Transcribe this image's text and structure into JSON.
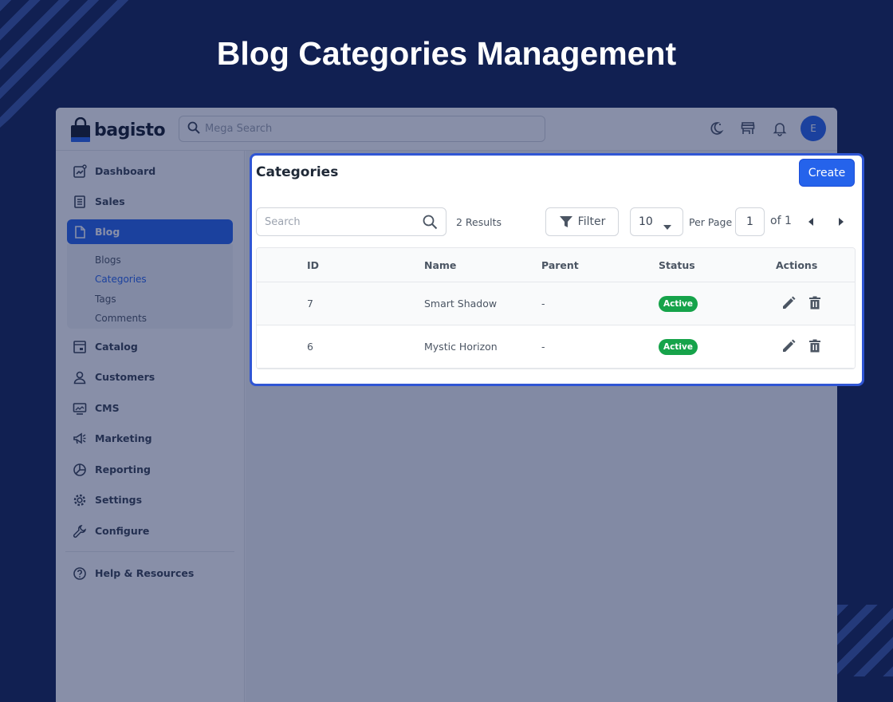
{
  "hero": {
    "title": "Blog Categories Management"
  },
  "app": {
    "logo_text": "bagisto",
    "search_placeholder": "Mega Search",
    "avatar_letter": "E"
  },
  "sidebar": {
    "items": [
      {
        "label": "Dashboard",
        "icon": "dashboard-icon"
      },
      {
        "label": "Sales",
        "icon": "receipt-icon"
      },
      {
        "label": "Blog",
        "icon": "document-icon"
      },
      {
        "label": "Catalog",
        "icon": "catalog-icon"
      },
      {
        "label": "Customers",
        "icon": "user-icon"
      },
      {
        "label": "CMS",
        "icon": "monitor-icon"
      },
      {
        "label": "Marketing",
        "icon": "megaphone-icon"
      },
      {
        "label": "Reporting",
        "icon": "pie-chart-icon"
      },
      {
        "label": "Settings",
        "icon": "gear-icon"
      },
      {
        "label": "Configure",
        "icon": "wrench-icon"
      },
      {
        "label": "Help & Resources",
        "icon": "question-icon"
      }
    ],
    "blog_submenu": [
      "Blogs",
      "Categories",
      "Tags",
      "Comments"
    ],
    "active_item": "Blog",
    "active_subitem": "Categories"
  },
  "panel": {
    "title": "Categories",
    "create_label": "Create",
    "search_placeholder": "Search",
    "results_text": "2 Results",
    "filter_label": "Filter",
    "per_page_value": "10",
    "per_page_label": "Per Page",
    "page_value": "1",
    "page_of": "of 1"
  },
  "table": {
    "columns": [
      "ID",
      "Name",
      "Parent",
      "Status",
      "Actions"
    ],
    "rows": [
      {
        "id": "7",
        "name": "Smart Shadow",
        "parent": "-",
        "status": "Active"
      },
      {
        "id": "6",
        "name": "Mystic Horizon",
        "parent": "-",
        "status": "Active"
      }
    ]
  },
  "colors": {
    "background": "#112052",
    "accent": "#2563eb",
    "panel_border": "#2f55d4",
    "status_active": "#16a34a"
  }
}
